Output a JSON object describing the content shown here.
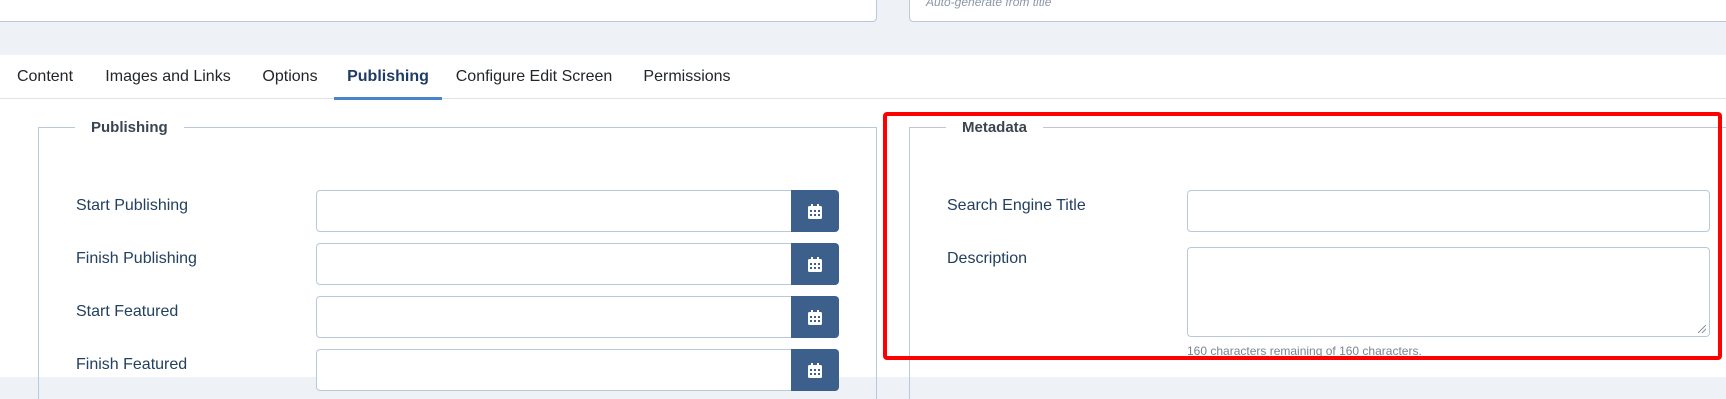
{
  "top": {
    "alias_placeholder": "Auto-generate from title"
  },
  "tabs": [
    {
      "label": "Content"
    },
    {
      "label": "Images and Links"
    },
    {
      "label": "Options"
    },
    {
      "label": "Publishing",
      "active": true
    },
    {
      "label": "Configure Edit Screen"
    },
    {
      "label": "Permissions"
    }
  ],
  "publishing": {
    "legend": "Publishing",
    "start_publishing_label": "Start Publishing",
    "finish_publishing_label": "Finish Publishing",
    "start_featured_label": "Start Featured",
    "finish_featured_label": "Finish Featured",
    "calendar_icon": "calendar-icon"
  },
  "metadata": {
    "legend": "Metadata",
    "search_engine_title_label": "Search Engine Title",
    "description_label": "Description",
    "char_counter": "160 characters remaining of 160 characters."
  },
  "colors": {
    "accent": "#4a84c8",
    "button": "#3d5f8c",
    "highlight": "#ff0000"
  }
}
